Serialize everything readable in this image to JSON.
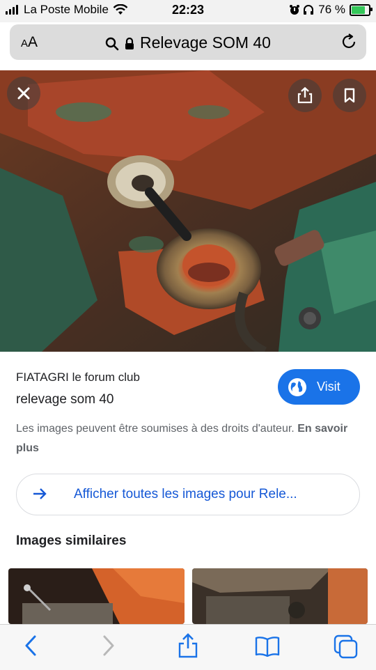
{
  "status_bar": {
    "carrier": "La Poste Mobile",
    "time": "22:23",
    "battery": "76 %"
  },
  "address_bar": {
    "text_size_label_small": "A",
    "text_size_label_large": "A",
    "url_text": "Relevage SOM 40"
  },
  "result": {
    "source": "FIATAGRI le forum club",
    "title": "relevage som 40",
    "visit_label": "Visit",
    "copyright_text": "Les images peuvent être soumises à des droits d'auteur.",
    "learn_more": "En savoir plus",
    "see_all_label": "Afficher toutes les images pour Rele...",
    "similar_heading": "Images similaires"
  },
  "icons": {
    "close": "close-icon",
    "share": "share-icon",
    "bookmark": "bookmark-icon",
    "search": "search-icon",
    "lock": "lock-icon",
    "reload": "reload-icon",
    "globe": "globe-icon",
    "arrow": "arrow-right-icon",
    "back": "chevron-left-icon",
    "forward": "chevron-right-icon",
    "books": "book-icon",
    "tabs": "tabs-icon"
  },
  "colors": {
    "accent": "#1a73e8",
    "link": "#1558d6",
    "status_bg": "#f2f2f2",
    "url_bar": "#dcdcdc",
    "battery_fill": "#34c759"
  }
}
